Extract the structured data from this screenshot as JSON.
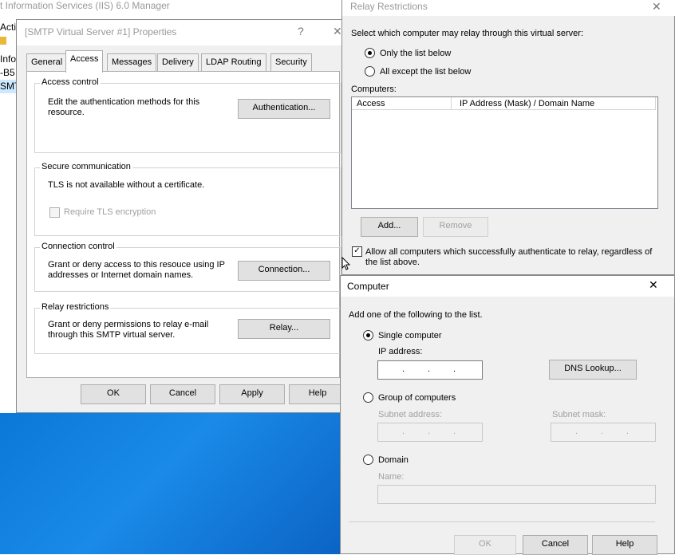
{
  "iis": {
    "title": "t Information Services (IIS) 6.0 Manager",
    "tree": [
      "Actio",
      "",
      "Info",
      "-B5",
      "SMT"
    ]
  },
  "props": {
    "title": "[SMTP Virtual Server #1] Properties",
    "help_glyph": "?",
    "close_glyph": "✕",
    "tabs": [
      "General",
      "Access",
      "Messages",
      "Delivery",
      "LDAP Routing",
      "Security"
    ],
    "active_tab": "Access",
    "access_control": {
      "label": "Access control",
      "desc": "Edit the authentication methods for this resource.",
      "button": "Authentication..."
    },
    "secure_comm": {
      "label": "Secure communication",
      "desc": "TLS is not available without a certificate.",
      "checkbox": "Require TLS encryption"
    },
    "connection_control": {
      "label": "Connection control",
      "desc": "Grant or deny access to this resouce using IP addresses or Internet domain names.",
      "button": "Connection..."
    },
    "relay_restrictions": {
      "label": "Relay restrictions",
      "desc": "Grant or deny permissions to relay e-mail through this SMTP virtual server.",
      "button": "Relay..."
    },
    "buttons": {
      "ok": "OK",
      "cancel": "Cancel",
      "apply": "Apply",
      "help": "Help"
    }
  },
  "relay": {
    "title": "Relay Restrictions",
    "close_glyph": "✕",
    "prompt": "Select which computer may relay through this virtual server:",
    "opt_only": "Only the list below",
    "opt_all_except": "All except the list below",
    "selected": "Only the list below",
    "computers_label": "Computers:",
    "columns": [
      "Access",
      "IP Address (Mask) / Domain Name"
    ],
    "add": "Add...",
    "remove": "Remove",
    "allow_auth": "Allow all computers which successfully authenticate to relay, regardless of the list above.",
    "allow_auth_checked": true
  },
  "computer": {
    "title": "Computer",
    "close_glyph": "✕",
    "prompt": "Add one of the following to the list.",
    "single": "Single computer",
    "ip_label": "IP address:",
    "dns_lookup": "DNS Lookup...",
    "group": "Group of computers",
    "subnet_address": "Subnet address:",
    "subnet_mask": "Subnet mask:",
    "domain": "Domain",
    "name_label": "Name:",
    "selected": "Single computer",
    "buttons": {
      "ok": "OK",
      "cancel": "Cancel",
      "help": "Help"
    }
  }
}
